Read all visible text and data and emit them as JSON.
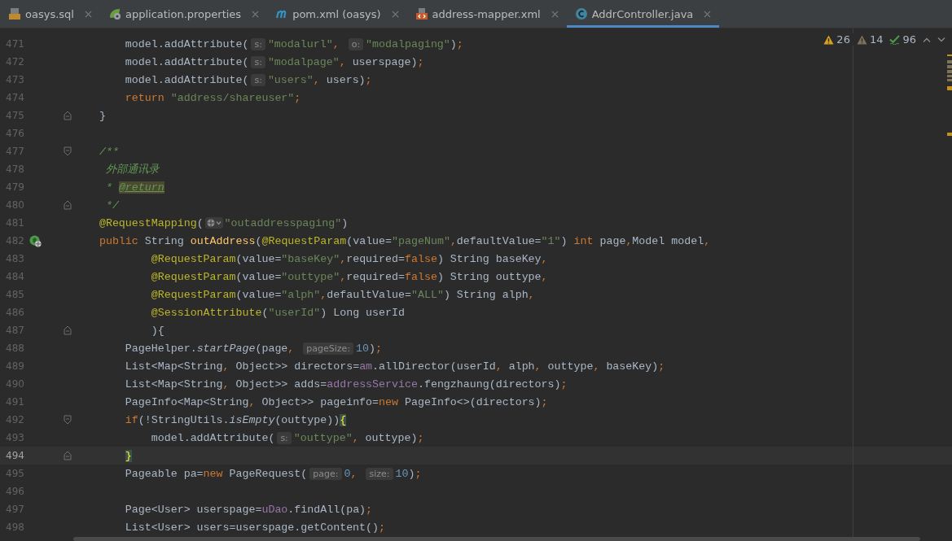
{
  "tabs": [
    {
      "label": "oasys.sql",
      "kind": "sql",
      "selected": false
    },
    {
      "label": "application.properties",
      "kind": "spring",
      "selected": false
    },
    {
      "label": "pom.xml (oasys)",
      "kind": "maven",
      "selected": false
    },
    {
      "label": "address-mapper.xml",
      "kind": "xml",
      "selected": false
    },
    {
      "label": "AddrController.java",
      "kind": "class",
      "selected": true
    }
  ],
  "inspections": [
    {
      "kind": "warning",
      "count": "26"
    },
    {
      "kind": "weak",
      "count": "14"
    },
    {
      "kind": "typo",
      "count": "96"
    }
  ],
  "lines": [
    {
      "number": "471",
      "kind": "plain",
      "tokens": [
        {
          "kind": "plain",
          "text": "        model.addAttribute("
        },
        {
          "kind": "hint",
          "text": "s:"
        },
        {
          "kind": "string",
          "text": "\"modalurl\""
        },
        {
          "kind": "keyword",
          "text": ", "
        },
        {
          "kind": "hint",
          "text": "o:"
        },
        {
          "kind": "string",
          "text": "\"modalpaging\""
        },
        {
          "kind": "plain",
          "text": ")"
        },
        {
          "kind": "keyword",
          "text": ";"
        }
      ]
    },
    {
      "number": "472",
      "kind": "plain",
      "tokens": [
        {
          "kind": "plain",
          "text": "        model.addAttribute("
        },
        {
          "kind": "hint",
          "text": "s:"
        },
        {
          "kind": "string",
          "text": "\"modalpage\""
        },
        {
          "kind": "keyword",
          "text": ","
        },
        {
          "kind": "plain",
          "text": " userspage)"
        },
        {
          "kind": "keyword",
          "text": ";"
        }
      ]
    },
    {
      "number": "473",
      "kind": "plain",
      "tokens": [
        {
          "kind": "plain",
          "text": "        model.addAttribute("
        },
        {
          "kind": "hint",
          "text": "s:"
        },
        {
          "kind": "string",
          "text": "\"users\""
        },
        {
          "kind": "keyword",
          "text": ","
        },
        {
          "kind": "plain",
          "text": " users)"
        },
        {
          "kind": "keyword",
          "text": ";"
        }
      ]
    },
    {
      "number": "474",
      "kind": "plain",
      "tokens": [
        {
          "kind": "keyword",
          "text": "        return "
        },
        {
          "kind": "string",
          "text": "\"address/shareuser\""
        },
        {
          "kind": "keyword",
          "text": ";"
        }
      ]
    },
    {
      "number": "475",
      "kind": "fold-end",
      "tokens": [
        {
          "kind": "plain",
          "text": "    }"
        }
      ]
    },
    {
      "number": "476",
      "kind": "plain"
    },
    {
      "number": "477",
      "kind": "fold-start",
      "tokens": [
        {
          "kind": "comment",
          "text": "    /**"
        }
      ]
    },
    {
      "number": "478",
      "kind": "plain",
      "tokens": [
        {
          "kind": "comment",
          "text": "     外部通讯录"
        }
      ]
    },
    {
      "number": "479",
      "kind": "plain",
      "tokens": [
        {
          "kind": "comment",
          "text": "     * "
        },
        {
          "kind": "doc-tag",
          "text": "@return"
        }
      ]
    },
    {
      "number": "480",
      "kind": "fold-end",
      "tokens": [
        {
          "kind": "comment",
          "text": "     */"
        }
      ]
    },
    {
      "number": "481",
      "kind": "plain",
      "tokens": [
        {
          "kind": "annotation",
          "text": "    @RequestMapping"
        },
        {
          "kind": "plain",
          "text": "("
        },
        {
          "kind": "globe"
        },
        {
          "kind": "string",
          "text": "\"outaddresspaging\""
        },
        {
          "kind": "plain",
          "text": ")"
        }
      ]
    },
    {
      "number": "482",
      "kind": "endpoint",
      "tokens": [
        {
          "kind": "keyword",
          "text": "    public "
        },
        {
          "kind": "plain",
          "text": "String "
        },
        {
          "kind": "declaration",
          "text": "outAddress"
        },
        {
          "kind": "plain",
          "text": "("
        },
        {
          "kind": "annotation",
          "text": "@RequestParam"
        },
        {
          "kind": "plain",
          "text": "(value="
        },
        {
          "kind": "string",
          "text": "\"pageNum\""
        },
        {
          "kind": "keyword",
          "text": ","
        },
        {
          "kind": "plain",
          "text": "defaultValue="
        },
        {
          "kind": "string",
          "text": "\"1\""
        },
        {
          "kind": "plain",
          "text": ") "
        },
        {
          "kind": "keyword",
          "text": "int "
        },
        {
          "kind": "plain",
          "text": "page"
        },
        {
          "kind": "keyword",
          "text": ","
        },
        {
          "kind": "plain",
          "text": "Model model"
        },
        {
          "kind": "keyword",
          "text": ","
        }
      ]
    },
    {
      "number": "483",
      "kind": "plain",
      "tokens": [
        {
          "kind": "annotation",
          "text": "            @RequestParam"
        },
        {
          "kind": "plain",
          "text": "(value="
        },
        {
          "kind": "string",
          "text": "\"baseKey\""
        },
        {
          "kind": "keyword",
          "text": ","
        },
        {
          "kind": "plain",
          "text": "required="
        },
        {
          "kind": "keyword",
          "text": "false"
        },
        {
          "kind": "plain",
          "text": ") String baseKey"
        },
        {
          "kind": "keyword",
          "text": ","
        }
      ]
    },
    {
      "number": "484",
      "kind": "plain",
      "tokens": [
        {
          "kind": "annotation",
          "text": "            @RequestParam"
        },
        {
          "kind": "plain",
          "text": "(value="
        },
        {
          "kind": "string",
          "text": "\"outtype\""
        },
        {
          "kind": "keyword",
          "text": ","
        },
        {
          "kind": "plain",
          "text": "required="
        },
        {
          "kind": "keyword",
          "text": "false"
        },
        {
          "kind": "plain",
          "text": ") String outtype"
        },
        {
          "kind": "keyword",
          "text": ","
        }
      ]
    },
    {
      "number": "485",
      "kind": "plain",
      "tokens": [
        {
          "kind": "annotation",
          "text": "            @RequestParam"
        },
        {
          "kind": "plain",
          "text": "(value="
        },
        {
          "kind": "string",
          "text": "\"alph\""
        },
        {
          "kind": "keyword",
          "text": ","
        },
        {
          "kind": "plain",
          "text": "defaultValue="
        },
        {
          "kind": "string",
          "text": "\"ALL\""
        },
        {
          "kind": "plain",
          "text": ") String alph"
        },
        {
          "kind": "keyword",
          "text": ","
        }
      ]
    },
    {
      "number": "486",
      "kind": "plain",
      "tokens": [
        {
          "kind": "annotation",
          "text": "            @SessionAttribute"
        },
        {
          "kind": "plain",
          "text": "("
        },
        {
          "kind": "string",
          "text": "\"userId\""
        },
        {
          "kind": "plain",
          "text": ") Long userId"
        }
      ]
    },
    {
      "number": "487",
      "kind": "fold-end",
      "tokens": [
        {
          "kind": "plain",
          "text": "            ){"
        }
      ]
    },
    {
      "number": "488",
      "kind": "plain",
      "tokens": [
        {
          "kind": "plain",
          "text": "        PageHelper."
        },
        {
          "kind": "static-call",
          "text": "startPage"
        },
        {
          "kind": "plain",
          "text": "(page"
        },
        {
          "kind": "keyword",
          "text": ", "
        },
        {
          "kind": "hint",
          "text": "pageSize:"
        },
        {
          "kind": "number",
          "text": "10"
        },
        {
          "kind": "plain",
          "text": ")"
        },
        {
          "kind": "keyword",
          "text": ";"
        }
      ]
    },
    {
      "number": "489",
      "kind": "plain",
      "tokens": [
        {
          "kind": "plain",
          "text": "        List<Map<String"
        },
        {
          "kind": "keyword",
          "text": ","
        },
        {
          "kind": "plain",
          "text": " Object>> directors="
        },
        {
          "kind": "field",
          "text": "am"
        },
        {
          "kind": "plain",
          "text": ".allDirector(userId"
        },
        {
          "kind": "keyword",
          "text": ","
        },
        {
          "kind": "plain",
          "text": " alph"
        },
        {
          "kind": "keyword",
          "text": ","
        },
        {
          "kind": "plain",
          "text": " outtype"
        },
        {
          "kind": "keyword",
          "text": ","
        },
        {
          "kind": "plain",
          "text": " baseKey)"
        },
        {
          "kind": "keyword",
          "text": ";"
        }
      ]
    },
    {
      "number": "490",
      "kind": "plain",
      "tokens": [
        {
          "kind": "plain",
          "text": "        List<Map<String"
        },
        {
          "kind": "keyword",
          "text": ","
        },
        {
          "kind": "plain",
          "text": " Object>> adds="
        },
        {
          "kind": "field",
          "text": "addressService"
        },
        {
          "kind": "plain",
          "text": ".fengzhaung(directors)"
        },
        {
          "kind": "keyword",
          "text": ";"
        }
      ]
    },
    {
      "number": "491",
      "kind": "plain",
      "tokens": [
        {
          "kind": "plain",
          "text": "        PageInfo<Map<String"
        },
        {
          "kind": "keyword",
          "text": ","
        },
        {
          "kind": "plain",
          "text": " Object>> pageinfo="
        },
        {
          "kind": "keyword",
          "text": "new "
        },
        {
          "kind": "plain",
          "text": "PageInfo<>(directors)"
        },
        {
          "kind": "keyword",
          "text": ";"
        }
      ]
    },
    {
      "number": "492",
      "kind": "fold-start",
      "tokens": [
        {
          "kind": "keyword",
          "text": "        if"
        },
        {
          "kind": "plain",
          "text": "(!StringUtils."
        },
        {
          "kind": "static-call",
          "text": "isEmpty"
        },
        {
          "kind": "plain",
          "text": "(outtype))"
        },
        {
          "kind": "brace",
          "text": "{"
        }
      ]
    },
    {
      "number": "493",
      "kind": "plain",
      "tokens": [
        {
          "kind": "plain",
          "text": "            model.addAttribute("
        },
        {
          "kind": "hint",
          "text": "s:"
        },
        {
          "kind": "string",
          "text": "\"outtype\""
        },
        {
          "kind": "keyword",
          "text": ","
        },
        {
          "kind": "plain",
          "text": " outtype)"
        },
        {
          "kind": "keyword",
          "text": ";"
        }
      ]
    },
    {
      "number": "494",
      "kind": "fold-end",
      "current": true,
      "tokens": [
        {
          "kind": "brace",
          "text": "        }"
        }
      ]
    },
    {
      "number": "495",
      "kind": "plain",
      "tokens": [
        {
          "kind": "plain",
          "text": "        Pageable pa="
        },
        {
          "kind": "keyword",
          "text": "new "
        },
        {
          "kind": "plain",
          "text": "PageRequest("
        },
        {
          "kind": "hint",
          "text": "page:"
        },
        {
          "kind": "number",
          "text": "0"
        },
        {
          "kind": "keyword",
          "text": ", "
        },
        {
          "kind": "hint",
          "text": "size:"
        },
        {
          "kind": "number",
          "text": "10"
        },
        {
          "kind": "plain",
          "text": ")"
        },
        {
          "kind": "keyword",
          "text": ";"
        }
      ]
    },
    {
      "number": "496",
      "kind": "plain"
    },
    {
      "number": "497",
      "kind": "plain",
      "tokens": [
        {
          "kind": "plain",
          "text": "        Page<User> userspage="
        },
        {
          "kind": "field",
          "text": "uDao"
        },
        {
          "kind": "plain",
          "text": ".findAll(pa)"
        },
        {
          "kind": "keyword",
          "text": ";"
        }
      ]
    },
    {
      "number": "498",
      "kind": "plain",
      "tokens": [
        {
          "kind": "plain",
          "text": "        List<User> users=userspage.getContent()"
        },
        {
          "kind": "keyword",
          "text": ";"
        }
      ]
    }
  ]
}
